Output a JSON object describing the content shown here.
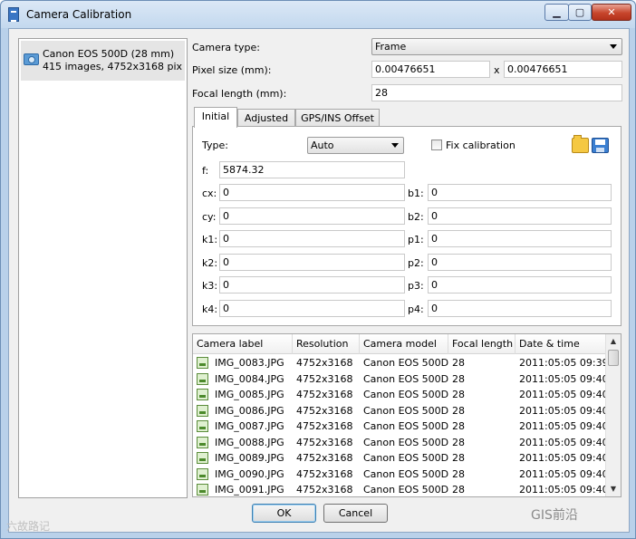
{
  "window": {
    "title": "Camera Calibration",
    "controls": {
      "minimize": "▁",
      "maximize": "▢",
      "close": "✕"
    }
  },
  "camera_list": [
    {
      "name": "Canon EOS 500D (28 mm)",
      "details": "415 images, 4752x3168 pix"
    }
  ],
  "settings": {
    "camera_type_label": "Camera type:",
    "camera_type_value": "Frame",
    "pixel_size_label": "Pixel size (mm):",
    "pixel_size_x": "0.00476651",
    "pixel_size_sep": "x",
    "pixel_size_y": "0.00476651",
    "focal_length_label": "Focal length (mm):",
    "focal_length_value": "28"
  },
  "tabs": [
    "Initial",
    "Adjusted",
    "GPS/INS Offset"
  ],
  "active_tab": "Initial",
  "initial": {
    "type_label": "Type:",
    "type_value": "Auto",
    "fix_calibration_label": "Fix calibration",
    "fix_calibration_checked": false,
    "f_label": "f:",
    "f_value": "5874.32",
    "left_params": [
      {
        "label": "cx:",
        "value": "0"
      },
      {
        "label": "cy:",
        "value": "0"
      },
      {
        "label": "k1:",
        "value": "0"
      },
      {
        "label": "k2:",
        "value": "0"
      },
      {
        "label": "k3:",
        "value": "0"
      },
      {
        "label": "k4:",
        "value": "0"
      }
    ],
    "right_params": [
      {
        "label": "b1:",
        "value": "0"
      },
      {
        "label": "b2:",
        "value": "0"
      },
      {
        "label": "p1:",
        "value": "0"
      },
      {
        "label": "p2:",
        "value": "0"
      },
      {
        "label": "p3:",
        "value": "0"
      },
      {
        "label": "p4:",
        "value": "0"
      }
    ]
  },
  "images_table": {
    "columns": [
      "Camera label",
      "Resolution",
      "Camera model",
      "Focal length",
      "Date & time"
    ],
    "rows": [
      [
        "IMG_0083.JPG",
        "4752x3168",
        "Canon EOS 500D",
        "28",
        "2011:05:05 09:39..."
      ],
      [
        "IMG_0084.JPG",
        "4752x3168",
        "Canon EOS 500D",
        "28",
        "2011:05:05 09:40..."
      ],
      [
        "IMG_0085.JPG",
        "4752x3168",
        "Canon EOS 500D",
        "28",
        "2011:05:05 09:40..."
      ],
      [
        "IMG_0086.JPG",
        "4752x3168",
        "Canon EOS 500D",
        "28",
        "2011:05:05 09:40..."
      ],
      [
        "IMG_0087.JPG",
        "4752x3168",
        "Canon EOS 500D",
        "28",
        "2011:05:05 09:40..."
      ],
      [
        "IMG_0088.JPG",
        "4752x3168",
        "Canon EOS 500D",
        "28",
        "2011:05:05 09:40..."
      ],
      [
        "IMG_0089.JPG",
        "4752x3168",
        "Canon EOS 500D",
        "28",
        "2011:05:05 09:40..."
      ],
      [
        "IMG_0090.JPG",
        "4752x3168",
        "Canon EOS 500D",
        "28",
        "2011:05:05 09:40..."
      ],
      [
        "IMG_0091.JPG",
        "4752x3168",
        "Canon EOS 500D",
        "28",
        "2011:05:05 09:40..."
      ]
    ]
  },
  "buttons": {
    "ok": "OK",
    "cancel": "Cancel"
  },
  "watermarks": {
    "left": "六故路记",
    "right": "GIS前沿"
  },
  "colors": {
    "title_bar": "#c3d8ee",
    "close_button": "#c7452c",
    "selection": "#e5e5e5"
  }
}
